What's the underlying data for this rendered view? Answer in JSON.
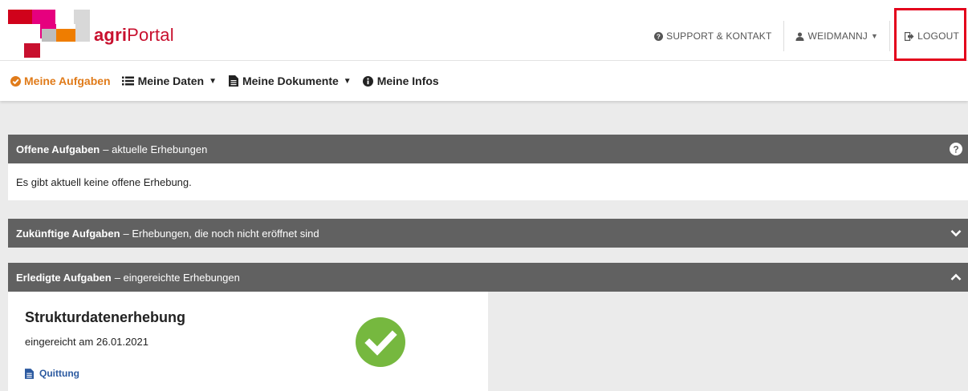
{
  "brand": {
    "prefix": "agri",
    "suffix": "Portal"
  },
  "topnav": {
    "support_label": "SUPPORT & KONTAKT",
    "user_label": "WEIDMANNJ",
    "logout_label": "LOGOUT"
  },
  "mainnav": {
    "tasks": "Meine Aufgaben",
    "data": "Meine Daten",
    "documents": "Meine Dokumente",
    "infos": "Meine Infos"
  },
  "panels": {
    "open": {
      "title": "Offene Aufgaben",
      "subtitle": "– aktuelle Erhebungen",
      "empty_text": "Es gibt aktuell keine offene Erhebung."
    },
    "future": {
      "title": "Zukünftige Aufgaben",
      "subtitle": "– Erhebungen, die noch nicht eröffnet sind"
    },
    "done": {
      "title": "Erledigte Aufgaben",
      "subtitle": "– eingereichte Erhebungen"
    }
  },
  "completed_card": {
    "title": "Strukturdatenerhebung",
    "date_text": "eingereicht am 26.01.2021",
    "link_label": "Quittung"
  },
  "colors": {
    "brand_red": "#c8102e",
    "active_orange": "#e07b1a",
    "panel_gray": "#616161",
    "success_green": "#76b83f",
    "link_blue": "#2c5aa0",
    "highlight_red": "#e3001b"
  }
}
